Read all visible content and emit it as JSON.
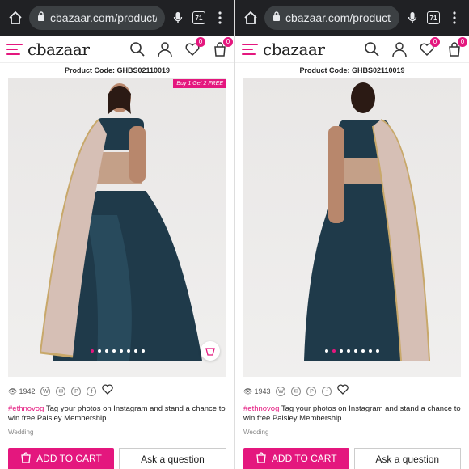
{
  "browser": {
    "url": "cbazaar.com/product/bl",
    "tab_count": "71"
  },
  "site": {
    "logo_text": "cbazaar",
    "wishlist_count": "0",
    "cart_count": "0"
  },
  "panels": [
    {
      "product_code": "Product Code: GHBS02110019",
      "offer": "Buy 1 Get 2 FREE",
      "views": "1942",
      "hashtag": "#ethnovog",
      "tagline": " Tag your photos on Instagram and stand a chance to win free Paisley Membership",
      "category": "Wedding",
      "add_to_cart": "ADD TO CART",
      "ask": "Ask a question"
    },
    {
      "product_code": "Product Code: GHBS02110019",
      "views": "1943",
      "hashtag": "#ethnovog",
      "tagline": " Tag your photos on Instagram and stand a chance to win free Paisley Membership",
      "category": "Wedding",
      "add_to_cart": "ADD TO CART",
      "ask": "Ask a question"
    }
  ],
  "colors": {
    "accent": "#e4177e",
    "lehenga": "#1f3a4a",
    "dupatta": "#d6bfb5"
  }
}
